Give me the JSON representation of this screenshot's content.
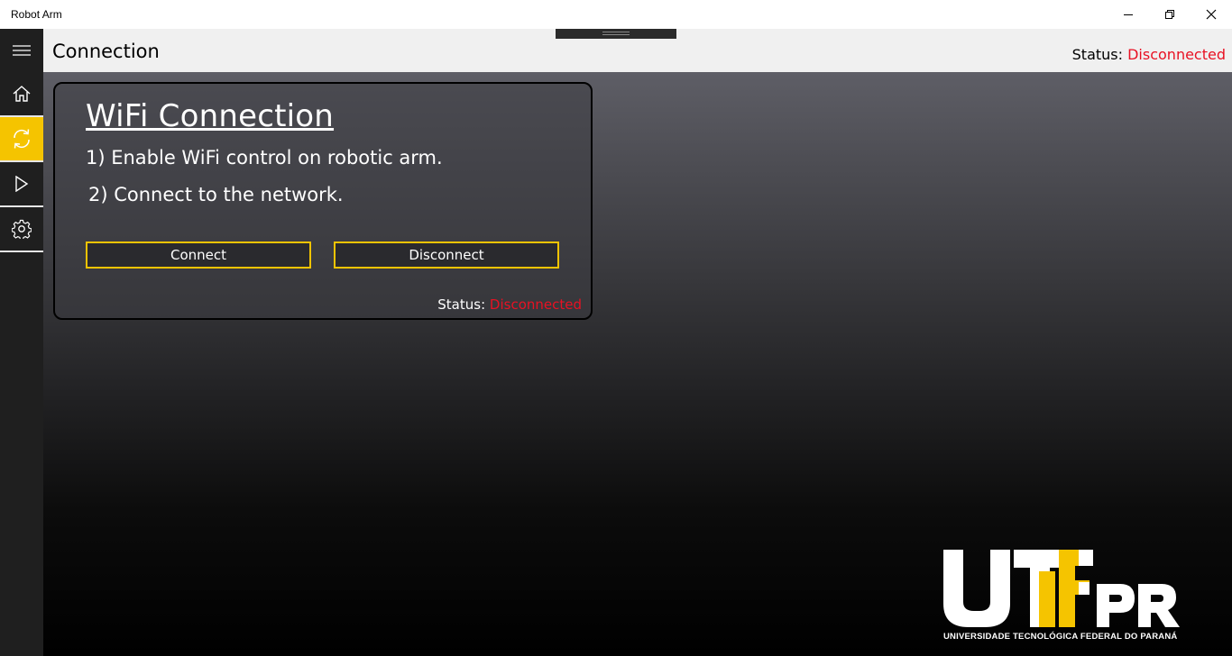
{
  "window": {
    "title": "Robot Arm",
    "controls": [
      "minimize-icon",
      "restore-icon",
      "close-icon"
    ]
  },
  "sidebar": {
    "items": [
      {
        "name": "hamburger-icon"
      },
      {
        "name": "home-icon"
      },
      {
        "name": "sync-icon",
        "active": true
      },
      {
        "name": "play-icon"
      },
      {
        "name": "gear-icon"
      }
    ],
    "active_color": "#f5c400"
  },
  "header": {
    "title": "Connection",
    "status_label": "Status:",
    "status_value": "Disconnected"
  },
  "card": {
    "title": "WiFi Connection",
    "step1": "1) Enable WiFi control on robotic arm.",
    "step2": "2) Connect to the network.",
    "connect_label": "Connect",
    "disconnect_label": "Disconnect",
    "status_label": "Status:",
    "status_value": "Disconnected"
  },
  "logo": {
    "name": "UTFPR",
    "subtitle": "UNIVERSIDADE TECNOLÓGICA FEDERAL DO PARANÁ"
  },
  "colors": {
    "accent": "#f5c400",
    "status_error": "#e81123"
  }
}
